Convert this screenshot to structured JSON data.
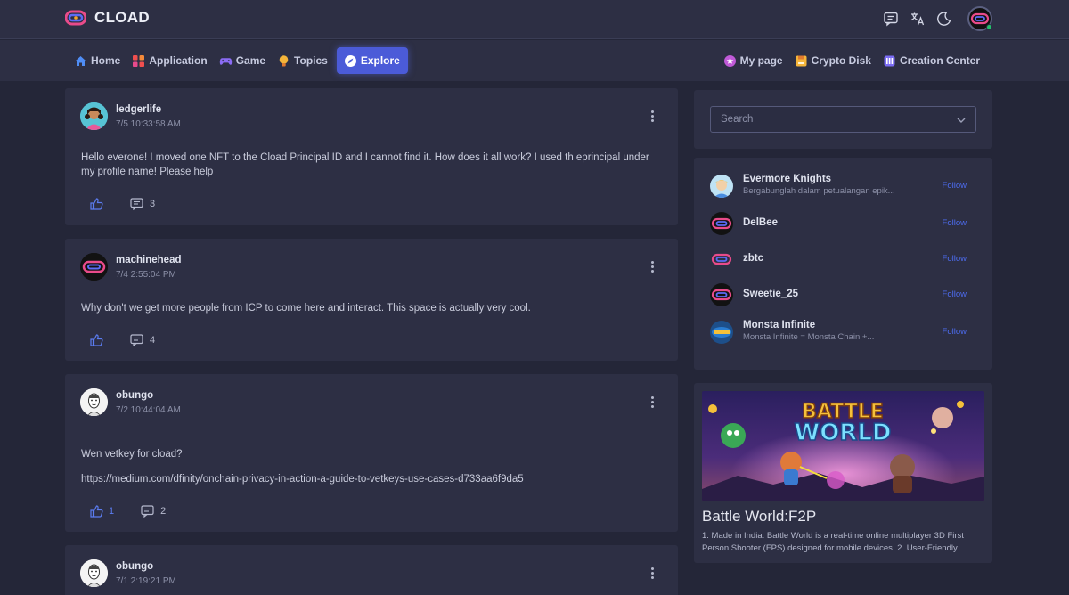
{
  "app": {
    "brand": "CLOAD"
  },
  "colors": {
    "accent": "#4b5bd8",
    "background": "#242638",
    "panel": "#2d2f44",
    "follow_link": "#4d6cf0",
    "online": "#21c16b"
  },
  "topbar": {
    "icons": [
      "chat-bubble-icon",
      "translate-icon",
      "moon-icon"
    ]
  },
  "nav": {
    "left": [
      {
        "label": "Home",
        "icon": "home-icon"
      },
      {
        "label": "Application",
        "icon": "apps-grid-icon"
      },
      {
        "label": "Game",
        "icon": "gamepad-icon"
      },
      {
        "label": "Topics",
        "icon": "lightbulb-icon"
      },
      {
        "label": "Explore",
        "icon": "compass-icon",
        "active": true
      }
    ],
    "right": [
      {
        "label": "My page",
        "icon": "star-badge-icon"
      },
      {
        "label": "Crypto Disk",
        "icon": "disk-icon"
      },
      {
        "label": "Creation Center",
        "icon": "creation-icon"
      }
    ]
  },
  "posts": [
    {
      "username": "ledgerlife",
      "time": "7/5 10:33:58 AM",
      "body": [
        "Hello everone! I moved one NFT to the Cload Principal ID and I cannot find it. How does it all work? I used th eprincipal under my profile name! Please help"
      ],
      "likes": "",
      "comments": "3"
    },
    {
      "username": "machinehead",
      "time": "7/4 2:55:04 PM",
      "body": [
        "Why don't we get more people from ICP to come here and interact. This space is actually very cool."
      ],
      "likes": "",
      "comments": "4"
    },
    {
      "username": "obungo",
      "time": "7/2 10:44:04 AM",
      "body": [
        "Wen vetkey for cload?",
        "https://medium.com/dfinity/onchain-privacy-in-action-a-guide-to-vetkeys-use-cases-d733aa6f9da5"
      ],
      "likes": "1",
      "comments": "2"
    },
    {
      "username": "obungo",
      "time": "7/1 2:19:21 PM",
      "body": [],
      "likes": "",
      "comments": ""
    }
  ],
  "search": {
    "placeholder": "Search"
  },
  "follow_list": {
    "button_label": "Follow",
    "items": [
      {
        "name": "Evermore Knights",
        "desc": "Bergabunglah dalam petualangan epik..."
      },
      {
        "name": "DelBee",
        "desc": ""
      },
      {
        "name": "zbtc",
        "desc": ""
      },
      {
        "name": "Sweetie_25",
        "desc": ""
      },
      {
        "name": "Monsta Infinite",
        "desc": "Monsta Infinite = Monsta Chain +..."
      }
    ]
  },
  "featured_game": {
    "title": "Battle World:F2P",
    "image_text": "BATTLE WORLD",
    "description": "1. Made in India: Battle World is a real-time online multiplayer 3D First Person Shooter (FPS) designed for mobile devices. 2. User-Friendly..."
  }
}
